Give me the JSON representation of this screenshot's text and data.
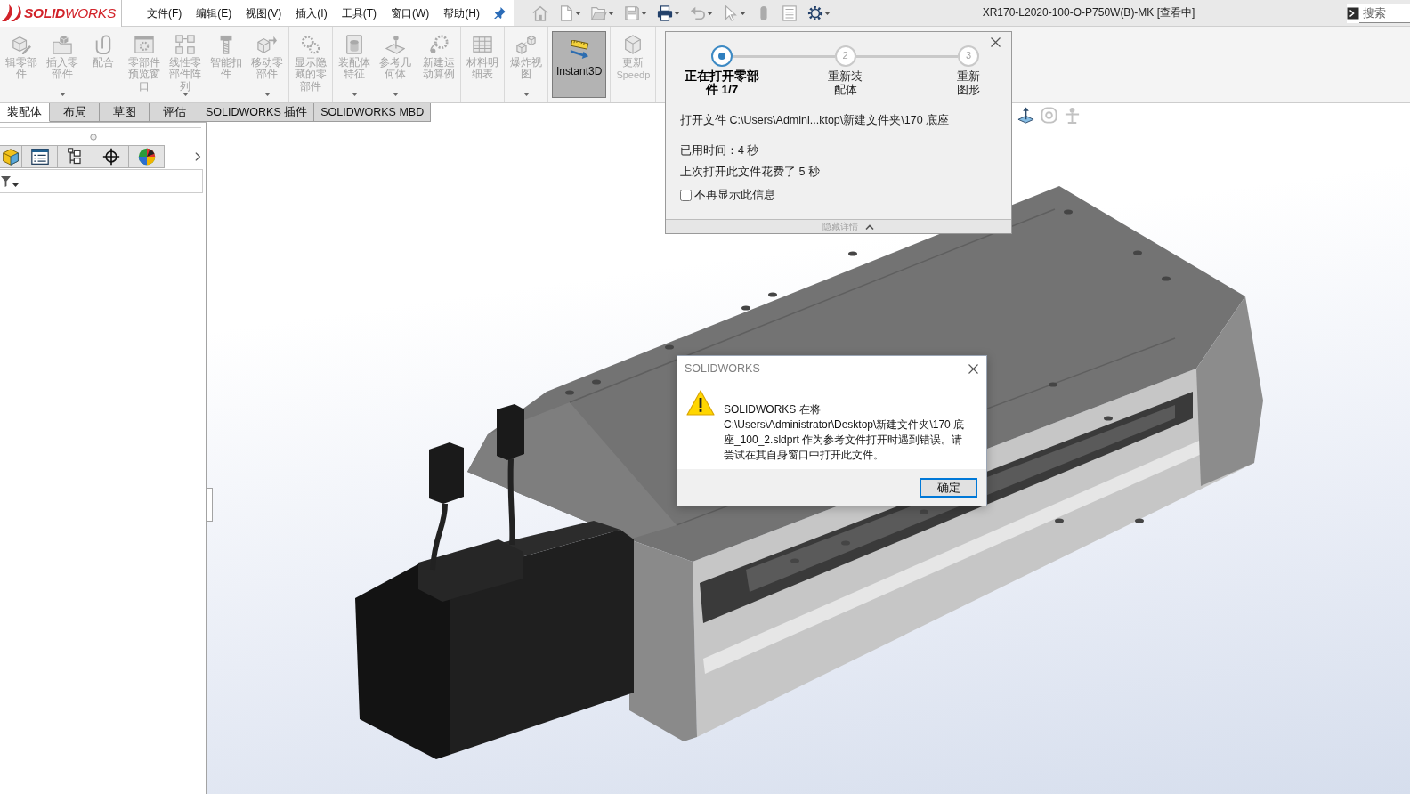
{
  "title_bar": {
    "logo": "**SOLID**WORKS",
    "menu": [
      "文件(F)",
      "编辑(E)",
      "视图(V)",
      "插入(I)",
      "工具(T)",
      "窗口(W)",
      "帮助(H)"
    ],
    "quick_access": [
      {
        "disabled": true,
        "dropdown": false
      },
      {
        "disabled": true,
        "dropdown": true
      },
      {
        "disabled": true,
        "dropdown": true
      },
      {
        "disabled": true,
        "dropdown": true
      },
      {
        "disabled": false,
        "dropdown": true
      },
      {
        "disabled": true,
        "dropdown": true
      },
      {
        "disabled": true,
        "dropdown": true
      },
      {
        "disabled": true,
        "dropdown": false
      },
      {
        "disabled": true,
        "dropdown": false
      },
      {
        "disabled": false,
        "dropdown": true
      }
    ],
    "title": "XR170-L2020-100-O-P750W(B)-MK [查看中]",
    "search": {
      "placeholder": "搜索"
    }
  },
  "command_manager": {
    "groups": [
      {
        "buttons": [
          {
            "label": "辑零部件",
            "disabled": true,
            "on": false,
            "dropdown": false
          },
          {
            "label": "插入零部件",
            "disabled": true,
            "on": false,
            "dropdown": true
          },
          {
            "label": "配合",
            "disabled": true,
            "on": false,
            "dropdown": false
          },
          {
            "label": "零部件预览窗口",
            "disabled": true,
            "on": false,
            "dropdown": false
          },
          {
            "label": "线性零部件阵列",
            "disabled": true,
            "on": false,
            "dropdown": true
          },
          {
            "label": "智能扣件",
            "disabled": true,
            "on": false,
            "dropdown": false
          },
          {
            "label": "移动零部件",
            "disabled": true,
            "on": false,
            "dropdown": true
          }
        ]
      },
      {
        "buttons": [
          {
            "label": "显示隐藏的零部件",
            "disabled": true,
            "on": false,
            "dropdown": false
          }
        ]
      },
      {
        "buttons": [
          {
            "label": "装配体特征",
            "disabled": true,
            "on": false,
            "dropdown": true
          },
          {
            "label": "参考几何体",
            "disabled": true,
            "on": false,
            "dropdown": true
          }
        ]
      },
      {
        "buttons": [
          {
            "label": "新建运动算例",
            "disabled": true,
            "on": false,
            "dropdown": false
          }
        ]
      },
      {
        "buttons": [
          {
            "label": "材料明细表",
            "disabled": true,
            "on": false,
            "dropdown": false
          }
        ]
      },
      {
        "buttons": [
          {
            "label": "爆炸视图",
            "disabled": true,
            "on": false,
            "dropdown": true
          }
        ]
      },
      {
        "buttons": [
          {
            "label": "Instant3D",
            "disabled": false,
            "on": true,
            "dropdown": false
          }
        ]
      },
      {
        "buttons": [
          {
            "label": "更新",
            "sublabel": "Speedp",
            "disabled": true,
            "on": false,
            "dropdown": false
          }
        ]
      }
    ]
  },
  "tabs": [
    {
      "label": "装配体",
      "selected": true
    },
    {
      "label": "布局",
      "selected": false
    },
    {
      "label": "草图",
      "selected": false
    },
    {
      "label": "评估",
      "selected": false
    },
    {
      "label": "SOLIDWORKS 插件",
      "selected": false
    },
    {
      "label": "SOLIDWORKS MBD",
      "selected": false
    }
  ],
  "heads_up_toolbar": [
    {
      "disabled": false
    },
    {
      "disabled": true
    },
    {
      "disabled": true
    }
  ],
  "progress_dialog": {
    "steps": [
      {
        "label": "正在打开零部件 1/7",
        "selected": true
      },
      {
        "number": "2",
        "label": "重新装配体",
        "selected": false
      },
      {
        "number": "3",
        "label": "重新图形",
        "selected": false
      }
    ],
    "file": "打开文件 C:\\Users\\Admini...ktop\\新建文件夹\\170 底座",
    "elapsed": "已用时间：4 秒",
    "previous": "上次打开此文件花费了 5 秒",
    "dont_show_again": {
      "label": "不再显示此信息",
      "checked": false
    },
    "details_toggle": {
      "label": "隐藏详情",
      "expanded": true
    }
  },
  "error_dialog": {
    "title": "SOLIDWORKS",
    "message": "SOLIDWORKS 在将 C:\\Users\\Administrator\\Desktop\\新建文件夹\\170 底座_100_2.sldprt 作为参考文件打开时遇到错误。请尝试在其自身窗口中打开此文件。",
    "buttons": [
      {
        "label": "确定",
        "default": true
      }
    ]
  }
}
